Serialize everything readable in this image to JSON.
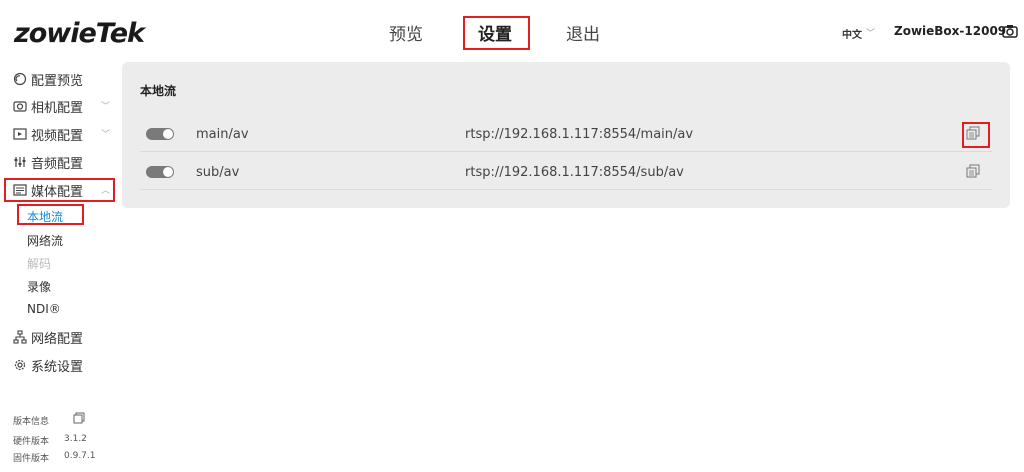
{
  "header": {
    "logo": "zowieTek",
    "nav": [
      {
        "label": "预览"
      },
      {
        "label": "设置"
      },
      {
        "label": "退出"
      }
    ],
    "language": "中文",
    "device_name": "ZowieBox-12009"
  },
  "sidebar": {
    "items": [
      {
        "label": "配置预览",
        "icon": "preview-icon"
      },
      {
        "label": "相机配置",
        "icon": "camera-icon"
      },
      {
        "label": "视频配置",
        "icon": "video-icon"
      },
      {
        "label": "音频配置",
        "icon": "audio-icon"
      },
      {
        "label": "媒体配置",
        "icon": "media-icon"
      },
      {
        "label": "网络配置",
        "icon": "network-icon"
      },
      {
        "label": "系统设置",
        "icon": "gear-icon"
      }
    ],
    "media_sub": [
      {
        "label": "本地流",
        "state": "active"
      },
      {
        "label": "网络流",
        "state": "normal"
      },
      {
        "label": "解码",
        "state": "disabled"
      },
      {
        "label": "录像",
        "state": "normal"
      },
      {
        "label": "NDI®",
        "state": "normal"
      }
    ],
    "version": {
      "title": "版本信息",
      "hardware_label": "硬件版本",
      "hardware_value": "3.1.2",
      "firmware_label": "固件版本",
      "firmware_value": "0.9.7.1"
    }
  },
  "main": {
    "title": "本地流",
    "streams": [
      {
        "name": "main/av",
        "url": "rtsp://192.168.1.117:8554/main/av",
        "enabled": true
      },
      {
        "name": "sub/av",
        "url": "rtsp://192.168.1.117:8554/sub/av",
        "enabled": true
      }
    ]
  },
  "colors": {
    "highlight": "#e02020",
    "active": "#1a8ad4",
    "panel": "#ececec"
  }
}
